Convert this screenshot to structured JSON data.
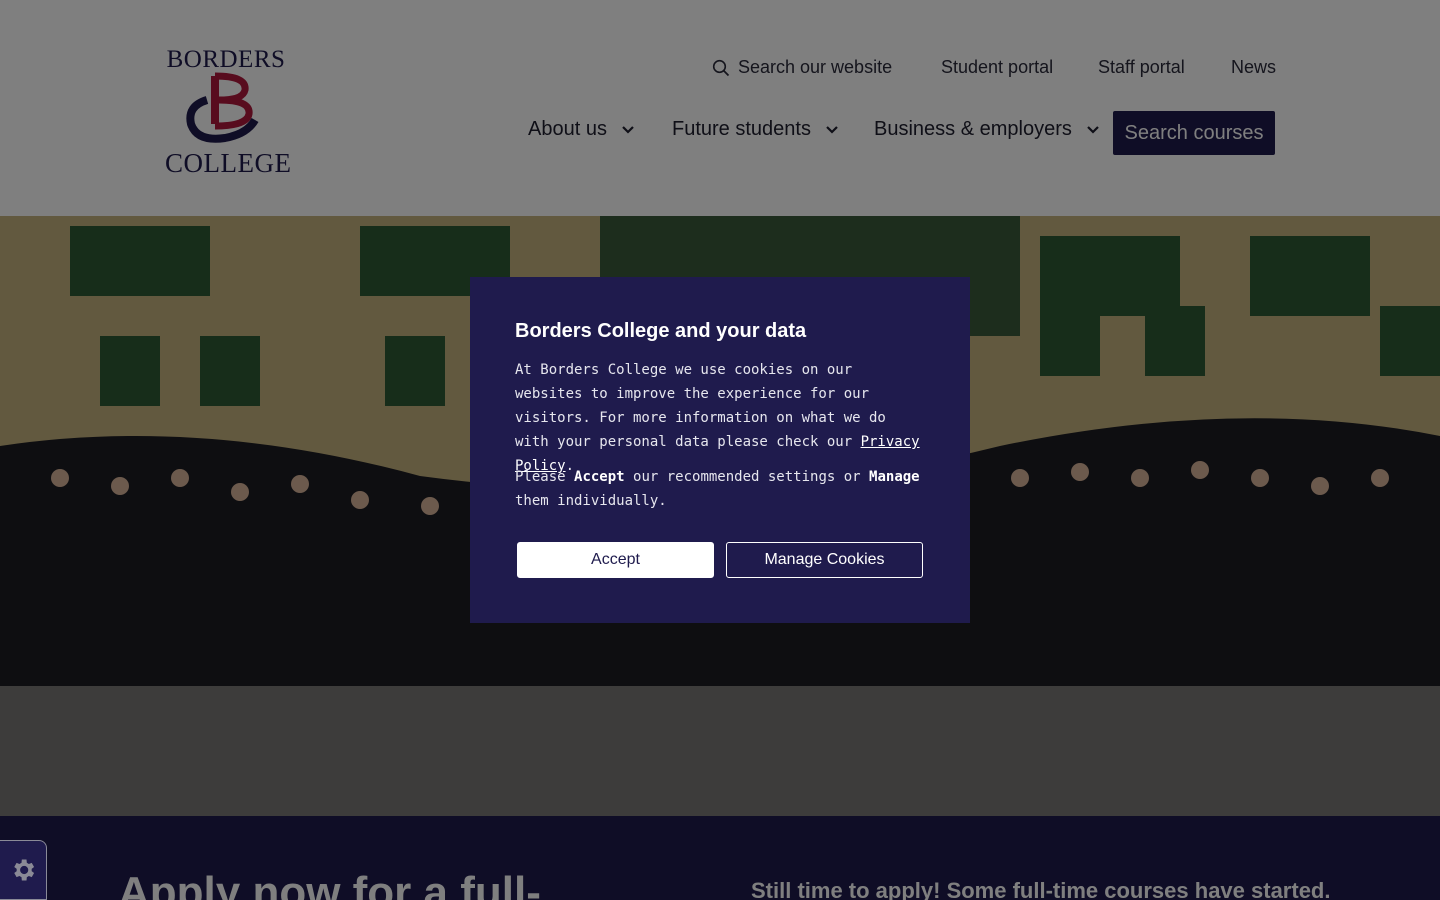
{
  "logo": {
    "line1": "BORDERS",
    "line2": "COLLEGE"
  },
  "utility_nav": {
    "search_label": "Search our website",
    "items": [
      "Student portal",
      "Staff portal",
      "News"
    ]
  },
  "main_nav": {
    "items": [
      "About us",
      "Future students",
      "Business & employers"
    ],
    "cta": "Search courses"
  },
  "band": {
    "heading": "Apply now for a full-",
    "subtext": "Still time to apply! Some full-time courses have started."
  },
  "cookie_dialog": {
    "title": "Borders College and your data",
    "body_before_link": "At Borders College we use cookies on our websites to improve the experience for our visitors. For more information on what we do with your personal data please check our ",
    "link": "Privacy Policy",
    "body_after_link": ".",
    "line2_prefix": "Please ",
    "accept_word": "Accept",
    "line2_middle": " our recommended settings or ",
    "manage_word": "Manage",
    "line2_suffix": " them individually.",
    "accept_button": "Accept",
    "manage_button": "Manage Cookies"
  },
  "colors": {
    "brand_navy": "#1f1b4d",
    "brand_red": "#b0183c",
    "overlay": "rgba(0,0,0,0.5)"
  },
  "icons": [
    "search-icon",
    "chevron-down-icon",
    "gear-icon"
  ]
}
